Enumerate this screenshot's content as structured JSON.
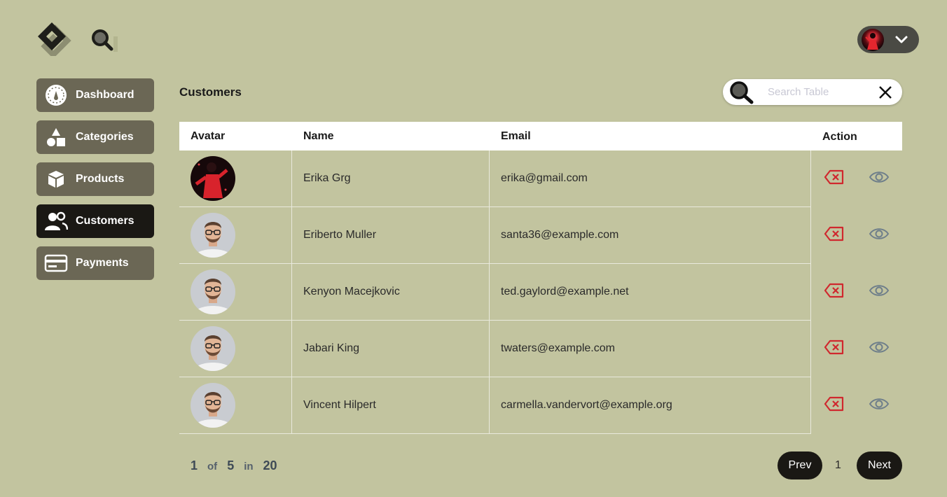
{
  "header": {
    "logo_icon": "diamond-logo-icon",
    "search_icon": "search-icon",
    "user_menu_icon": "chevron-down-icon"
  },
  "sidebar": {
    "items": [
      {
        "label": "Dashboard",
        "icon": "speedometer-icon",
        "active": false
      },
      {
        "label": "Categories",
        "icon": "shapes-icon",
        "active": false
      },
      {
        "label": "Products",
        "icon": "box-icon",
        "active": false
      },
      {
        "label": "Customers",
        "icon": "users-icon",
        "active": true
      },
      {
        "label": "Payments",
        "icon": "credit-card-icon",
        "active": false
      }
    ]
  },
  "main": {
    "title": "Customers",
    "search": {
      "placeholder": "Search Table",
      "value": ""
    }
  },
  "table": {
    "columns": [
      "Avatar",
      "Name",
      "Email",
      "Action"
    ],
    "rows": [
      {
        "name": "Erika Grg",
        "email": "erika@gmail.com",
        "avatar": "red-outfit-avatar"
      },
      {
        "name": "Eriberto Muller",
        "email": "santa36@example.com",
        "avatar": "glasses-man-avatar"
      },
      {
        "name": "Kenyon Macejkovic",
        "email": "ted.gaylord@example.net",
        "avatar": "glasses-man-avatar"
      },
      {
        "name": "Jabari King",
        "email": "twaters@example.com",
        "avatar": "glasses-man-avatar"
      },
      {
        "name": "Vincent Hilpert",
        "email": "carmella.vandervort@example.org",
        "avatar": "glasses-man-avatar"
      }
    ]
  },
  "pagination": {
    "current": "1",
    "of_label": "of",
    "total_pages": "5",
    "in_label": "in",
    "total_items": "20",
    "prev_label": "Prev",
    "page": "1",
    "next_label": "Next"
  },
  "colors": {
    "background": "#c2c49f",
    "sidebar_item": "#6b6755",
    "active_item": "#1a1814",
    "delete_icon": "#d0282e",
    "view_icon": "#6e7e8a"
  }
}
